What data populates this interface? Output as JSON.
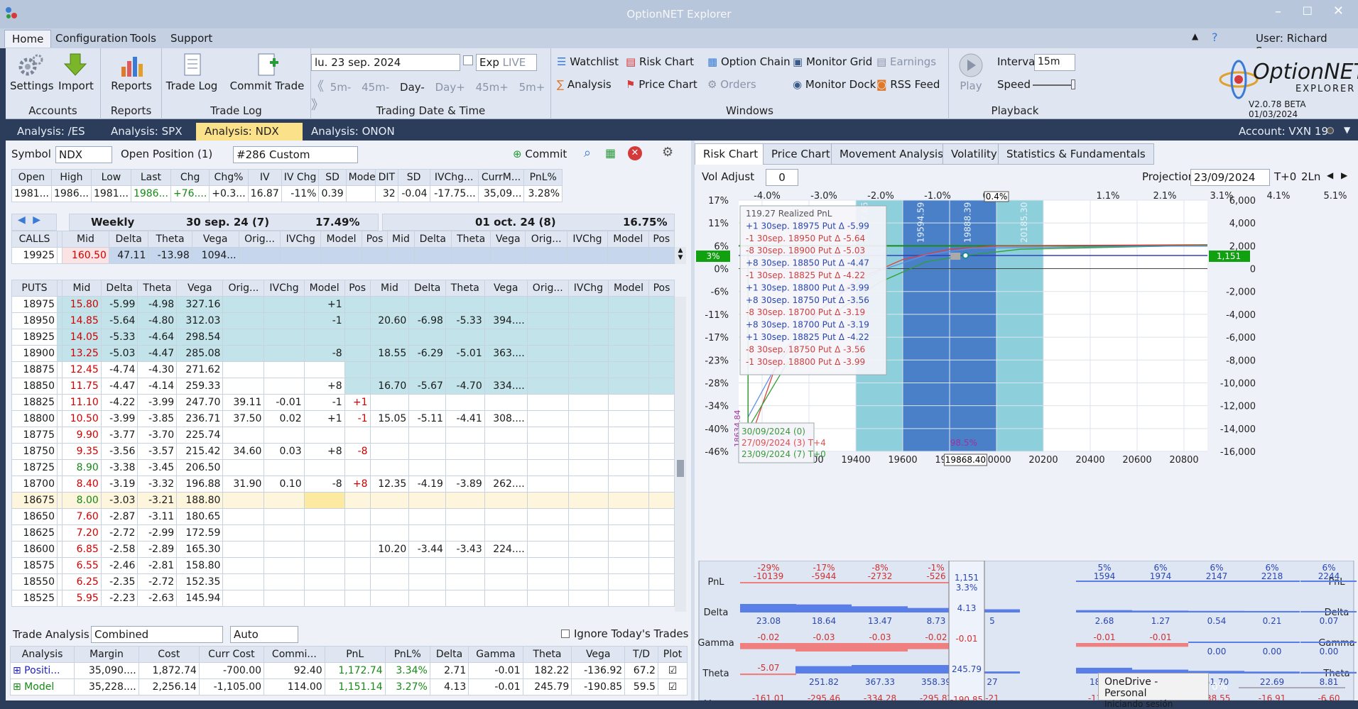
{
  "app": {
    "title": "OptionNET Explorer",
    "user": "User: Richard Saenz",
    "version": "V2.0.78 BETA 01/03/2024",
    "logo_top": "OptionNET",
    "logo_bottom": "EXPLORER"
  },
  "menu": [
    "Home",
    "Configuration",
    "Tools",
    "Support"
  ],
  "ribbon": {
    "accounts": {
      "label": "Accounts",
      "settings": "Settings",
      "import": "Import"
    },
    "reports": {
      "label": "Reports",
      "reports": "Reports"
    },
    "tradelog": {
      "label": "Trade Log",
      "trade_log": "Trade Log",
      "commit_trade": "Commit Trade"
    },
    "trading": {
      "label": "Trading Date & Time",
      "date": "lu. 23 sep. 2024",
      "exp": "Exp",
      "live": "LIVE",
      "steps": [
        "5m-",
        "45m-",
        "Day-",
        "Day+",
        "45m+",
        "5m+"
      ]
    },
    "windows": {
      "label": "Windows",
      "items": [
        "Watchlist",
        "Risk Chart",
        "Option Chain",
        "Monitor Grid",
        "Earnings",
        "Analysis",
        "Price Chart",
        "Orders",
        "Monitor Dock",
        "RSS Feed"
      ]
    },
    "playback": {
      "label": "Playback",
      "play": "Play",
      "interval_label": "Interval",
      "interval": "15m",
      "speed": "Speed"
    }
  },
  "doc_tabs": [
    "Analysis: /ES",
    "Analysis: SPX",
    "Analysis: NDX",
    "Analysis: ONON"
  ],
  "account": "Account: VXN 19",
  "symbol_row": {
    "symbol_label": "Symbol",
    "symbol": "NDX",
    "open_pos_label": "Open Position (1)",
    "position": "#286 Custom",
    "commit": "Commit"
  },
  "quote": {
    "headers": [
      "Open",
      "High",
      "Low",
      "Last",
      "Chg",
      "Chg%",
      "IV",
      "IV Chg",
      "SD",
      "Model",
      "Position"
    ],
    "values": [
      "1981...",
      "1986...",
      "1981...",
      "1986...",
      "+76....",
      "+0.3...",
      "16.87",
      "-11%",
      "0.39",
      "",
      ""
    ]
  },
  "stats": {
    "headers": [
      "DIT",
      "SD",
      "IVChg...",
      "CurrM...",
      "PnL%"
    ],
    "values": [
      "32",
      "-0.04",
      "-17.75...",
      "35,09...",
      "3.28%"
    ]
  },
  "expiries": {
    "left": {
      "name": "Weekly",
      "date": "30 sep. 24 (7)",
      "iv": "17.49%"
    },
    "right": {
      "date": "01 oct. 24 (8)",
      "iv": "16.75%"
    }
  },
  "calls": {
    "label": "CALLS",
    "headers": [
      "Mid",
      "Delta",
      "Theta",
      "Vega",
      "Orig...",
      "IVChg",
      "Model",
      "Pos"
    ],
    "row": {
      "strike": "19925",
      "mid": "160.50",
      "delta": "47.11",
      "theta": "-13.98",
      "vega": "1094..."
    }
  },
  "puts": {
    "label": "PUTS",
    "headers": [
      "Mid",
      "Delta",
      "Theta",
      "Vega",
      "Orig...",
      "IVChg",
      "Model",
      "Pos"
    ],
    "rows": [
      [
        "18975",
        "15.80",
        "-5.99",
        "-4.98",
        "327.16",
        "",
        "",
        "+1",
        "",
        "",
        "",
        "",
        "",
        ""
      ],
      [
        "18950",
        "14.85",
        "-5.64",
        "-4.80",
        "312.03",
        "",
        "",
        "-1",
        "",
        "20.60",
        "-6.98",
        "-5.33",
        "394...."
      ],
      [
        "18925",
        "14.05",
        "-5.33",
        "-4.64",
        "298.54",
        "",
        "",
        "",
        "",
        "",
        "",
        "",
        ""
      ],
      [
        "18900",
        "13.25",
        "-5.03",
        "-4.47",
        "285.08",
        "",
        "",
        "-8",
        "",
        "18.55",
        "-6.29",
        "-5.01",
        "363...."
      ],
      [
        "18875",
        "12.45",
        "-4.74",
        "-4.30",
        "271.62",
        "",
        "",
        "",
        "",
        "",
        "",
        "",
        ""
      ],
      [
        "18850",
        "11.75",
        "-4.47",
        "-4.14",
        "259.33",
        "",
        "",
        "+8",
        "",
        "16.70",
        "-5.67",
        "-4.70",
        "334...."
      ],
      [
        "18825",
        "11.10",
        "-4.22",
        "-3.99",
        "247.70",
        "39.11",
        "-0.01",
        "-1",
        "+1",
        "",
        "",
        "",
        ""
      ],
      [
        "18800",
        "10.50",
        "-3.99",
        "-3.85",
        "236.71",
        "37.50",
        "0.02",
        "+1",
        "-1",
        "15.05",
        "-5.11",
        "-4.41",
        "308...."
      ],
      [
        "18775",
        "9.90",
        "-3.77",
        "-3.70",
        "225.74",
        "",
        "",
        "",
        "",
        "",
        "",
        "",
        ""
      ],
      [
        "18750",
        "9.35",
        "-3.56",
        "-3.57",
        "215.42",
        "34.60",
        "0.03",
        "+8",
        "-8",
        "",
        "",
        "",
        ""
      ],
      [
        "18725",
        "8.90",
        "-3.38",
        "-3.45",
        "206.50",
        "",
        "",
        "",
        "",
        "",
        "",
        "",
        ""
      ],
      [
        "18700",
        "8.40",
        "-3.19",
        "-3.32",
        "196.88",
        "31.90",
        "0.10",
        "-8",
        "+8",
        "12.35",
        "-4.19",
        "-3.89",
        "262...."
      ],
      [
        "18675",
        "8.00",
        "-3.03",
        "-3.21",
        "188.80",
        "",
        "",
        "",
        "",
        "",
        "",
        "",
        ""
      ],
      [
        "18650",
        "7.60",
        "-2.87",
        "-3.11",
        "180.65",
        "",
        "",
        "",
        "",
        "",
        "",
        "",
        ""
      ],
      [
        "18625",
        "7.20",
        "-2.72",
        "-2.99",
        "172.59",
        "",
        "",
        "",
        "",
        "",
        "",
        "",
        ""
      ],
      [
        "18600",
        "6.85",
        "-2.58",
        "-2.89",
        "165.30",
        "",
        "",
        "",
        "",
        "10.20",
        "-3.44",
        "-3.43",
        "224...."
      ],
      [
        "18575",
        "6.55",
        "-2.46",
        "-2.81",
        "158.80",
        "",
        "",
        "",
        "",
        "",
        "",
        "",
        ""
      ],
      [
        "18550",
        "6.25",
        "-2.35",
        "-2.72",
        "152.35",
        "",
        "",
        "",
        "",
        "",
        "",
        "",
        ""
      ],
      [
        "18525",
        "5.95",
        "-2.23",
        "-2.63",
        "145.94",
        "",
        "",
        "",
        "",
        "",
        "",
        "",
        ""
      ]
    ]
  },
  "trade_analysis": {
    "label": "Trade Analysis",
    "mode": "Combined",
    "auto": "Auto",
    "ignore": "Ignore Today's Trades",
    "headers": [
      "Analysis",
      "Margin",
      "Cost",
      "Curr Cost",
      "Commi...",
      "PnL",
      "PnL%",
      "Delta",
      "Gamma",
      "Theta",
      "Vega",
      "T/D",
      "Plot"
    ],
    "rows": [
      [
        "Positi...",
        "35,090....",
        "1,872.74",
        "-700.00",
        "92.40",
        "1,172.74",
        "3.34%",
        "2.71",
        "-0.01",
        "182.22",
        "-136.92",
        "67.2"
      ],
      [
        "Model",
        "35,228....",
        "2,256.14",
        "-1,105.00",
        "114.00",
        "1,151.14",
        "3.27%",
        "4.13",
        "-0.01",
        "245.79",
        "-190.85",
        "59.5"
      ]
    ]
  },
  "right_tabs": [
    "Risk Chart",
    "Price Chart",
    "Movement Analysis",
    "Volatility",
    "Statistics & Fundamentals"
  ],
  "risk_controls": {
    "vol_adjust_label": "Vol Adjust",
    "vol_adjust": "0",
    "projection_label": "Projection",
    "projection": "23/09/2024",
    "tplus": "T+0",
    "ln": "2Ln"
  },
  "chart_data": {
    "type": "line",
    "x_ticks": [
      "19000",
      "19200",
      "19400",
      "19600",
      "19800",
      "20000",
      "20200",
      "20400",
      "20600",
      "20800"
    ],
    "top_pct_ticks": [
      "-4.0%",
      "-3.0%",
      "-2.0%",
      "-1.0%",
      "0.0%",
      "0.4%",
      "1.1%",
      "2.1%",
      "3.1%",
      "4.1%",
      "5.1%"
    ],
    "left_pct_ticks": [
      "17%",
      "11%",
      "6%",
      "0%",
      "-6%",
      "-11%",
      "-17%",
      "-23%",
      "-28%",
      "-34%",
      "-40%",
      "-46%"
    ],
    "right_ticks": [
      "6,000",
      "4,000",
      "2,000",
      "0",
      "-2,000",
      "-4,000",
      "-6,000",
      "-8,000",
      "-10,000",
      "-12,000",
      "-14,000",
      "-16,000"
    ],
    "ylim": [
      -16000,
      6000
    ],
    "current_pnl": "1,151",
    "current_pct": "3%",
    "price_marker": "19868.40",
    "prob": "98.5%",
    "band_labels": [
      "19597.66",
      "19594.59",
      "19888.39",
      "20185.30"
    ],
    "low_label": "18634.84",
    "legend": [
      "119.27 Realized PnL",
      "+1 30sep. 18975 Put Δ -5.99",
      "-1 30sep. 18950 Put Δ -5.64",
      "-8 30sep. 18900 Put Δ -5.03",
      "+8 30sep. 18850 Put Δ -4.47",
      "-1 30sep. 18825 Put Δ -4.22",
      "+1 30sep. 18800 Put Δ -3.99",
      "+8 30sep. 18750 Put Δ -3.56",
      "-8 30sep. 18700 Put Δ -3.19",
      "+8 30sep. 18700 Put Δ -3.19",
      "+1 30sep. 18825 Put Δ -4.22",
      "-8 30sep. 18750 Put Δ -3.56",
      "-1 30sep. 18800 Put Δ -3.99"
    ],
    "series": [
      {
        "name": "30/09/2024 (0)",
        "color": "#3a9a3a"
      },
      {
        "name": "27/09/2024 (3) T+4",
        "color": "#e05050"
      },
      {
        "name": "23/09/2024 (7) T+0",
        "color": "#3a9a3a"
      }
    ]
  },
  "greeks": {
    "rows": [
      {
        "label": "PnL",
        "values": [
          "-29%",
          "-17%",
          "-8%",
          "-1%",
          "",
          "",
          "5%",
          "6%",
          "6%",
          "6%",
          "6%"
        ],
        "values2": [
          "-10139",
          "-5944",
          "-2732",
          "-526",
          "",
          "",
          "1594",
          "1974",
          "2147",
          "2218",
          "2244"
        ],
        "current": "1,151",
        "current2": "3.3%"
      },
      {
        "label": "Delta",
        "values": [
          "23.08",
          "18.64",
          "13.47",
          "8.73",
          "5",
          "",
          "2.68",
          "1.27",
          "0.54",
          "0.21",
          "0.07"
        ],
        "current": "4.13"
      },
      {
        "label": "Gamma",
        "values": [
          "-0.02",
          "-0.03",
          "-0.03",
          "-0.02",
          "",
          "",
          "-0.01",
          "-0.01",
          "0.00",
          "0.00",
          "0.00"
        ],
        "current": "-0.01"
      },
      {
        "label": "Theta",
        "values": [
          "-5.07",
          "251.82",
          "367.33",
          "358.39",
          "27",
          "",
          "183.08",
          "103.93",
          "51.70",
          "22.69",
          "8.81"
        ],
        "current": "245.79"
      },
      {
        "label": "Vega",
        "values": [
          "-161.01",
          "-295.46",
          "-334.28",
          "-295.82",
          "-21",
          "",
          "-139.79",
          "-78.10",
          "-38.55",
          "-16.91",
          "-6.60"
        ],
        "current": "-190.85"
      }
    ]
  },
  "onedrive": {
    "title": "OneDrive - Personal",
    "sub": "Iniciando sesión"
  },
  "zoom": "0%"
}
